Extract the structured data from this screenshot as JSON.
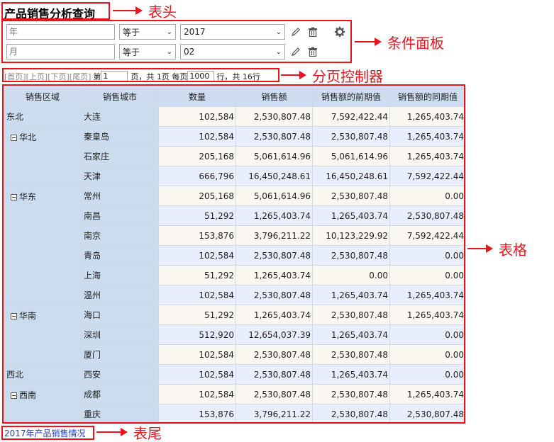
{
  "title": "产品销售分析查询",
  "conditions": [
    {
      "placeholder": "年",
      "operator": "等于",
      "value": "2017"
    },
    {
      "placeholder": "月",
      "operator": "等于",
      "value": "02"
    }
  ],
  "pager": {
    "first": "[首页]",
    "prev": "[上页]",
    "next": "[下页]",
    "last": "[尾页]",
    "page_label": "第",
    "page_value": "1",
    "page_suffix": "页，共 1页 每页",
    "rows_value": "1000",
    "rows_suffix": "行，共 16行"
  },
  "table": {
    "headers": [
      "销售区域",
      "销售城市",
      "数量",
      "销售额",
      "销售额的前期值",
      "销售额的同期值"
    ],
    "rows": [
      {
        "region": "东北",
        "expand": false,
        "span": 1,
        "city": "大连",
        "values": [
          "102,584",
          "2,530,807.48",
          "7,592,422.44",
          "1,265,403.74"
        ]
      },
      {
        "region": "华北",
        "expand": true,
        "span": 3,
        "city": "秦皇岛",
        "values": [
          "102,584",
          "2,530,807.48",
          "2,530,807.48",
          "1,265,403.74"
        ]
      },
      {
        "city": "石家庄",
        "values": [
          "205,168",
          "5,061,614.96",
          "5,061,614.96",
          "1,265,403.74"
        ]
      },
      {
        "city": "天津",
        "values": [
          "666,796",
          "16,450,248.61",
          "16,450,248.61",
          "7,592,422.44"
        ]
      },
      {
        "region": "华东",
        "expand": true,
        "span": 6,
        "city": "常州",
        "values": [
          "205,168",
          "5,061,614.96",
          "2,530,807.48",
          "0.00"
        ]
      },
      {
        "city": "南昌",
        "values": [
          "51,292",
          "1,265,403.74",
          "1,265,403.74",
          "2,530,807.48"
        ]
      },
      {
        "city": "南京",
        "values": [
          "153,876",
          "3,796,211.22",
          "10,123,229.92",
          "7,592,422.44"
        ]
      },
      {
        "city": "青岛",
        "values": [
          "102,584",
          "2,530,807.48",
          "2,530,807.48",
          "0.00"
        ]
      },
      {
        "city": "上海",
        "values": [
          "51,292",
          "1,265,403.74",
          "0.00",
          "0.00"
        ]
      },
      {
        "city": "温州",
        "values": [
          "102,584",
          "2,530,807.48",
          "1,265,403.74",
          "1,265,403.74"
        ]
      },
      {
        "region": "华南",
        "expand": true,
        "span": 3,
        "city": "海口",
        "values": [
          "51,292",
          "1,265,403.74",
          "2,530,807.48",
          "1,265,403.74"
        ]
      },
      {
        "city": "深圳",
        "values": [
          "512,920",
          "12,654,037.39",
          "1,265,403.74",
          "0.00"
        ]
      },
      {
        "city": "厦门",
        "values": [
          "102,584",
          "2,530,807.48",
          "2,530,807.48",
          "0.00"
        ]
      },
      {
        "region": "西北",
        "expand": false,
        "span": 1,
        "city": "西安",
        "values": [
          "102,584",
          "2,530,807.48",
          "1,265,403.74",
          "0.00"
        ]
      },
      {
        "region": "西南",
        "expand": true,
        "span": 2,
        "city": "成都",
        "values": [
          "102,584",
          "2,530,807.48",
          "2,530,807.48",
          "1,265,403.74"
        ]
      },
      {
        "city": "重庆",
        "values": [
          "153,876",
          "3,796,211.22",
          "2,530,807.48",
          "2,530,807.48"
        ]
      }
    ]
  },
  "footer": "2017年产品销售情况",
  "callouts": {
    "header": "表头",
    "condition_panel": "条件面板",
    "pager": "分页控制器",
    "table": "表格",
    "footer": "表尾"
  },
  "colors": {
    "annotation": "#e8141b",
    "header_bg": "#cddcee",
    "dimension_bg": "#cbdcee",
    "row_a": "#faf7f0",
    "row_b": "#e8eefc",
    "footer_text": "#1f3ecb"
  },
  "icons": {
    "edit": "pencil-icon",
    "delete": "trash-icon",
    "settings": "gear-icon",
    "expand": "collapse-minus-icon"
  }
}
